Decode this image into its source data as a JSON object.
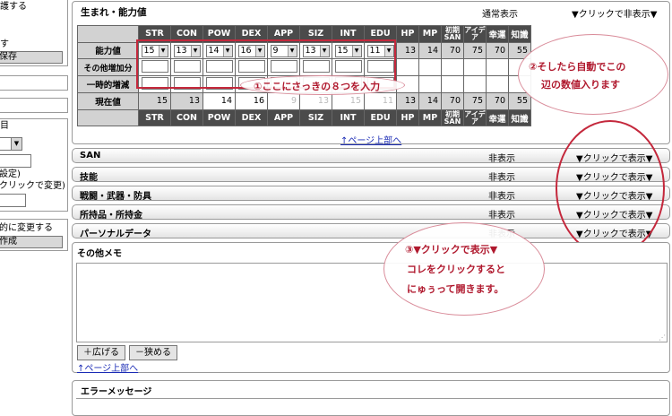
{
  "sidebar": {
    "panel1_lines": [
      "護する",
      "",
      "す"
    ],
    "panel1_button": "保存",
    "panel3_title": "目",
    "panel3_lines": [
      "設定)",
      "クリックで変更)"
    ],
    "panel4_line": "的に変更する",
    "panel4_button": "作成"
  },
  "stats_section": {
    "title": "生まれ・能力値",
    "status": "通常表示",
    "toggle": "▼クリックで非表示▼",
    "headers": [
      "STR",
      "CON",
      "POW",
      "DEX",
      "APP",
      "SIZ",
      "INT",
      "EDU",
      "HP",
      "MP",
      "初期SAN",
      "アイデア",
      "幸運",
      "知識"
    ],
    "row_labels": {
      "ability": "能力値",
      "other": "その他増加分",
      "temp": "一時的増減",
      "current": "現在値"
    },
    "ability_values": [
      "15",
      "13",
      "14",
      "16",
      "9",
      "13",
      "15",
      "11"
    ],
    "derived_values": [
      "13",
      "14",
      "70",
      "75",
      "70",
      "55"
    ],
    "current_values": [
      "15",
      "13",
      "14",
      "16",
      "9",
      "13",
      "15",
      "11",
      "13",
      "14",
      "70",
      "75",
      "70",
      "55"
    ],
    "page_top_link": "↑ページ上部へ"
  },
  "collapsed_sections": [
    {
      "title": "SAN",
      "status": "非表示",
      "toggle": "▼クリックで表示▼"
    },
    {
      "title": "技能",
      "status": "非表示",
      "toggle": "▼クリックで表示▼"
    },
    {
      "title": "戦闘・武器・防具",
      "status": "非表示",
      "toggle": "▼クリックで表示▼"
    },
    {
      "title": "所持品・所持金",
      "status": "非表示",
      "toggle": "▼クリックで表示▼"
    },
    {
      "title": "パーソナルデータ",
      "status": "非表示",
      "toggle": "▼クリックで表示▼"
    }
  ],
  "memo_section": {
    "title": "その他メモ",
    "expand_button": "＋広げる",
    "shrink_button": "－狭める",
    "page_top_link": "↑ページ上部へ"
  },
  "error_section": {
    "title": "エラーメッセージ"
  },
  "annotations": {
    "note1": "①ここにさっきの８つを入力",
    "note2_line1": "②そしたら自動でこの",
    "note2_line2": "辺の数値入ります",
    "note3_line1": "③▼クリックで表示▼",
    "note3_line2": "コレをクリックすると",
    "note3_line3": "にゅぅって開きます。",
    "color": "#b0192e"
  },
  "colors": {
    "header_dark": "#4b4b4b",
    "cell_grey": "#d2d2d2",
    "highlight_red": "#c4283c",
    "link": "#1a2bb5"
  }
}
